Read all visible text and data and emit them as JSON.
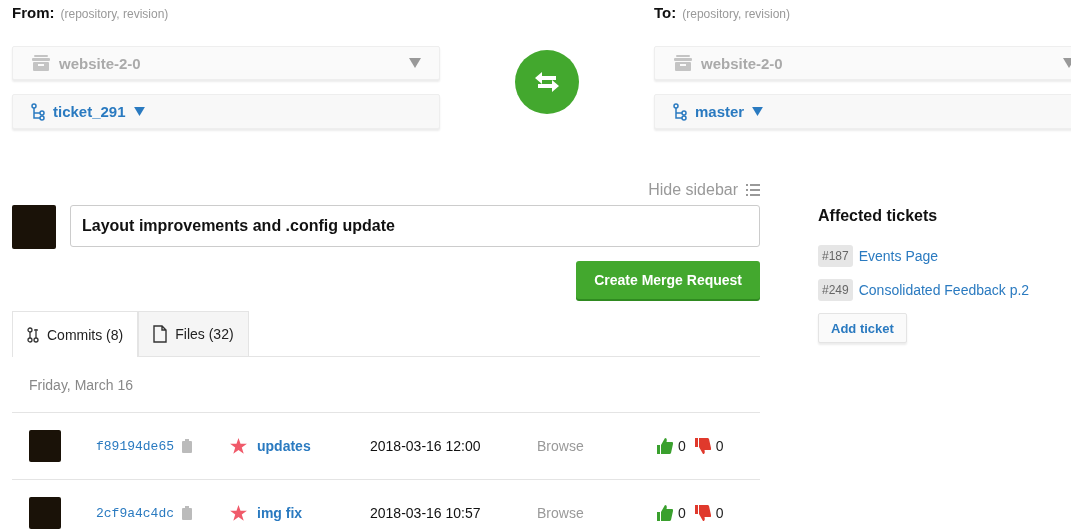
{
  "from": {
    "label": "From:",
    "hint": "(repository, revision)",
    "repository": "website-2-0",
    "branch": "ticket_291"
  },
  "to": {
    "label": "To:",
    "hint": "(repository, revision)",
    "repository": "website-2-0",
    "branch": "master"
  },
  "hide_sidebar": "Hide sidebar",
  "title_field": {
    "value": "Layout improvements and .config update"
  },
  "create_button": "Create Merge Request",
  "tabs": [
    {
      "label": "Commits (8)",
      "kind": "commits",
      "selected": true
    },
    {
      "label": "Files (32)",
      "kind": "files",
      "selected": false
    }
  ],
  "date_heading": "Friday, March 16",
  "commits": [
    {
      "hash": "f89194de65",
      "message": "updates",
      "date": "2018-03-16 12:00",
      "browse": "Browse",
      "likes": "0",
      "dislikes": "0"
    },
    {
      "hash": "2cf9a4c4dc",
      "message": "img fix",
      "date": "2018-03-16 10:57",
      "browse": "Browse",
      "likes": "0",
      "dislikes": "0"
    }
  ],
  "sidebar": {
    "title": "Affected tickets",
    "tickets": [
      {
        "number": "#187",
        "name": "Events Page"
      },
      {
        "number": "#249",
        "name": "Consolidated Feedback p.2"
      }
    ],
    "add_button": "Add ticket"
  }
}
